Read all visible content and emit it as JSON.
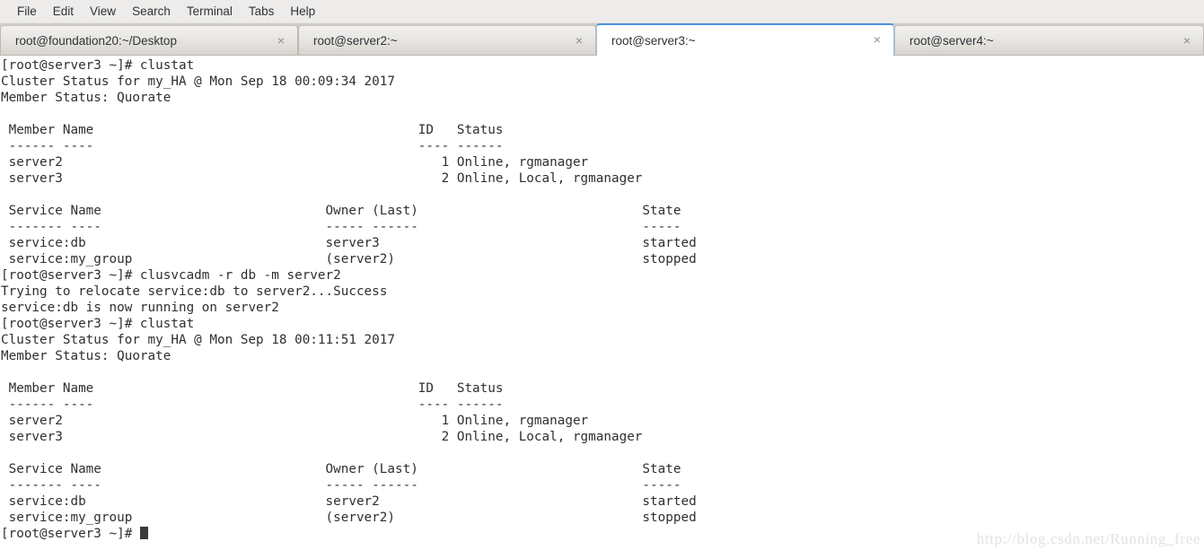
{
  "window": {
    "title": "root@server3:~"
  },
  "menubar": {
    "items": [
      {
        "label": "File"
      },
      {
        "label": "Edit"
      },
      {
        "label": "View"
      },
      {
        "label": "Search"
      },
      {
        "label": "Terminal"
      },
      {
        "label": "Tabs"
      },
      {
        "label": "Help"
      }
    ]
  },
  "tabs": {
    "close_glyph": "×",
    "items": [
      {
        "label": "root@foundation20:~/Desktop",
        "active": false
      },
      {
        "label": "root@server2:~",
        "active": false
      },
      {
        "label": "root@server3:~",
        "active": true
      },
      {
        "label": "root@server4:~",
        "active": false
      }
    ]
  },
  "terminal": {
    "prompt": "[root@server3 ~]# ",
    "colors": {
      "background": "#ffffff",
      "foreground": "#2f2f2f",
      "cursor": "#3b3b3b"
    },
    "lines": [
      "[root@server3 ~]# clustat",
      "Cluster Status for my_HA @ Mon Sep 18 00:09:34 2017",
      "Member Status: Quorate",
      "",
      " Member Name                                          ID   Status",
      " ------ ----                                          ---- ------",
      " server2                                                 1 Online, rgmanager",
      " server3                                                 2 Online, Local, rgmanager",
      "",
      " Service Name                             Owner (Last)                             State",
      " ------- ----                             ----- ------                             -----",
      " service:db                               server3                                  started",
      " service:my_group                         (server2)                                stopped",
      "[root@server3 ~]# clusvcadm -r db -m server2",
      "Trying to relocate service:db to server2...Success",
      "service:db is now running on server2",
      "[root@server3 ~]# clustat",
      "Cluster Status for my_HA @ Mon Sep 18 00:11:51 2017",
      "Member Status: Quorate",
      "",
      " Member Name                                          ID   Status",
      " ------ ----                                          ---- ------",
      " server2                                                 1 Online, rgmanager",
      " server3                                                 2 Online, Local, rgmanager",
      "",
      " Service Name                             Owner (Last)                             State",
      " ------- ----                             ----- ------                             -----",
      " service:db                               server2                                  started",
      " service:my_group                         (server2)                                stopped"
    ],
    "rows": [
      {
        "left": "[root@server3 ~]# clustat",
        "mid": "",
        "right": ""
      },
      {
        "left": "Cluster Status for my_HA @ Mon Sep 18 00:09:34 2017",
        "mid": "",
        "right": ""
      },
      {
        "left": "Member Status: Quorate",
        "mid": "",
        "right": ""
      },
      {
        "left": "",
        "mid": "",
        "right": ""
      },
      {
        "left": " Member Name",
        "mid": "ID   Status",
        "right": ""
      },
      {
        "left": " ------ ----",
        "mid": "---- ------",
        "right": ""
      },
      {
        "left": " server2",
        "mid": "   1 Online, rgmanager",
        "right": ""
      },
      {
        "left": " server3",
        "mid": "   2 Online, Local, rgmanager",
        "right": ""
      },
      {
        "left": "",
        "mid": "",
        "right": ""
      },
      {
        "left": " Service Name",
        "mid": "Owner (Last)",
        "right": "State"
      },
      {
        "left": " ------- ----",
        "mid": "----- ------",
        "right": "-----"
      },
      {
        "left": " service:db",
        "mid": "server3",
        "right": "started"
      },
      {
        "left": " service:my_group",
        "mid": "(server2)",
        "right": "stopped"
      },
      {
        "left": "[root@server3 ~]# clusvcadm -r db -m server2",
        "mid": "",
        "right": ""
      },
      {
        "left": "Trying to relocate service:db to server2...Success",
        "mid": "",
        "right": ""
      },
      {
        "left": "service:db is now running on server2",
        "mid": "",
        "right": ""
      },
      {
        "left": "[root@server3 ~]# clustat",
        "mid": "",
        "right": ""
      },
      {
        "left": "Cluster Status for my_HA @ Mon Sep 18 00:11:51 2017",
        "mid": "",
        "right": ""
      },
      {
        "left": "Member Status: Quorate",
        "mid": "",
        "right": ""
      },
      {
        "left": "",
        "mid": "",
        "right": ""
      },
      {
        "left": " Member Name",
        "mid": "ID   Status",
        "right": ""
      },
      {
        "left": " ------ ----",
        "mid": "---- ------",
        "right": ""
      },
      {
        "left": " server2",
        "mid": "   1 Online, rgmanager",
        "right": ""
      },
      {
        "left": " server3",
        "mid": "   2 Online, Local, rgmanager",
        "right": ""
      },
      {
        "left": "",
        "mid": "",
        "right": ""
      },
      {
        "left": " Service Name",
        "mid": "Owner (Last)",
        "right": "State"
      },
      {
        "left": " ------- ----",
        "mid": "----- ------",
        "right": "-----"
      },
      {
        "left": " service:db",
        "mid": "server2",
        "right": "started"
      },
      {
        "left": " service:my_group",
        "mid": "(server2)",
        "right": "stopped"
      }
    ],
    "last_line": "[root@server3 ~]# ",
    "cluster_status_1": {
      "header": "Cluster Status for my_HA @ Mon Sep 18 00:09:34 2017",
      "member_status": "Member Status: Quorate",
      "member_columns": [
        "Member Name",
        "ID",
        "Status"
      ],
      "members": [
        {
          "name": "server2",
          "id": "1",
          "status": "Online, rgmanager"
        },
        {
          "name": "server3",
          "id": "2",
          "status": "Online, Local, rgmanager"
        }
      ],
      "service_columns": [
        "Service Name",
        "Owner (Last)",
        "State"
      ],
      "services": [
        {
          "name": "service:db",
          "owner": "server3",
          "state": "started"
        },
        {
          "name": "service:my_group",
          "owner": "(server2)",
          "state": "stopped"
        }
      ]
    },
    "relocate_command": "clusvcadm -r db -m server2",
    "relocate_output": [
      "Trying to relocate service:db to server2...Success",
      "service:db is now running on server2"
    ],
    "cluster_status_2": {
      "header": "Cluster Status for my_HA @ Mon Sep 18 00:11:51 2017",
      "member_status": "Member Status: Quorate",
      "member_columns": [
        "Member Name",
        "ID",
        "Status"
      ],
      "members": [
        {
          "name": "server2",
          "id": "1",
          "status": "Online, rgmanager"
        },
        {
          "name": "server3",
          "id": "2",
          "status": "Online, Local, rgmanager"
        }
      ],
      "service_columns": [
        "Service Name",
        "Owner (Last)",
        "State"
      ],
      "services": [
        {
          "name": "service:db",
          "owner": "server2",
          "state": "started"
        },
        {
          "name": "service:my_group",
          "owner": "(server2)",
          "state": "stopped"
        }
      ]
    }
  },
  "watermark": {
    "text": "http://blog.csdn.net/Running_free"
  }
}
